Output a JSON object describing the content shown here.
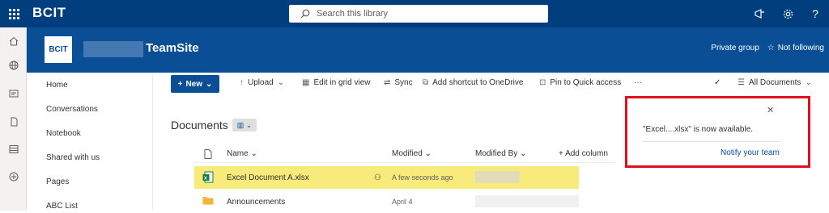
{
  "suite": {
    "brand": "BCIT",
    "search_placeholder": "Search this library",
    "icons": [
      "megaphone-icon",
      "gear-icon",
      "help-icon"
    ],
    "help_glyph": "?"
  },
  "site": {
    "logo_text": "BCIT",
    "title": "TeamSite",
    "group_type": "Private group",
    "follow_label": "Not following"
  },
  "quick_launch": [
    "Home",
    "Conversations",
    "Notebook",
    "Shared with us",
    "Pages",
    "ABC List"
  ],
  "commands": {
    "new": "New",
    "upload": "Upload",
    "edit_grid": "Edit in grid view",
    "sync": "Sync",
    "add_shortcut": "Add shortcut to OneDrive",
    "pin": "Pin to Quick access",
    "more": "···",
    "view": "All Documents"
  },
  "library": {
    "title": "Documents",
    "columns": {
      "name": "Name",
      "modified": "Modified",
      "modified_by": "Modified By",
      "add": "Add column"
    },
    "rows": [
      {
        "name": "Excel Document A.xlsx",
        "modified": "A few seconds ago",
        "type": "excel"
      },
      {
        "name": "Announcements",
        "modified": "April 4",
        "type": "folder"
      }
    ]
  },
  "notification": {
    "message": "\"Excel....xlsx\" is now available.",
    "action": "Notify your team"
  },
  "colors": {
    "suite": "#003e7e",
    "header": "#0a4f95",
    "highlight": "#f9ea7c",
    "callout": "#e0101f"
  }
}
